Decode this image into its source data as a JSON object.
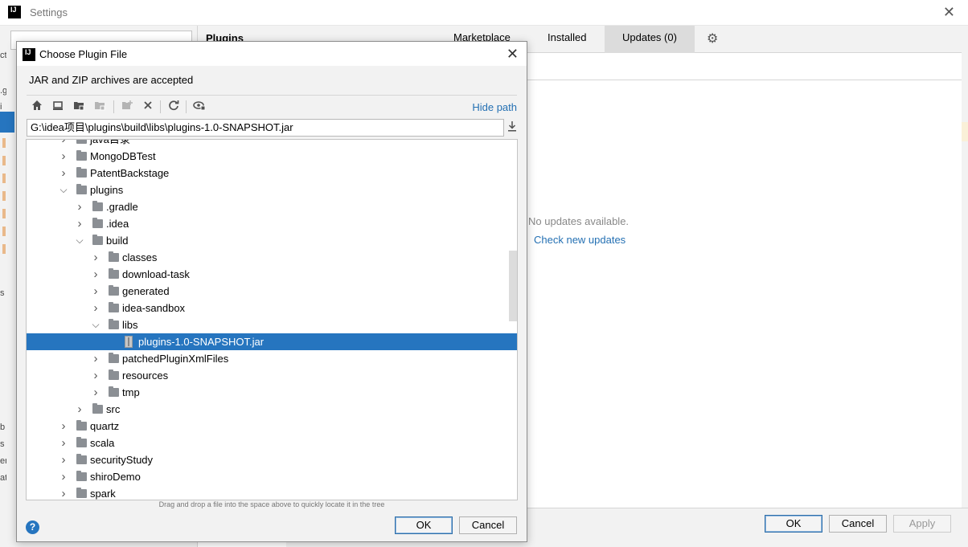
{
  "settings": {
    "logo": "IJ",
    "title": "Settings",
    "close_icon": "✕",
    "left_strip": [
      "ct",
      ".g",
      "i",
      "b",
      "s",
      "b",
      "s",
      "er",
      "at"
    ],
    "plugins": {
      "title": "Plugins",
      "tabs": [
        "Marketplace",
        "Installed",
        "Updates (0)"
      ],
      "active_tab": "Updates (0)",
      "gear_icon": "⚙"
    },
    "content": {
      "no_updates": "No updates available.",
      "check_link": "Check new updates"
    },
    "footer": {
      "ok": "OK",
      "cancel": "Cancel",
      "apply": "Apply"
    }
  },
  "dialog": {
    "logo": "IJ",
    "title": "Choose Plugin File",
    "close_icon": "✕",
    "description": "JAR and ZIP archives are accepted",
    "toolbar": {
      "icons": [
        "home-icon",
        "desktop-icon",
        "project-folder-icon",
        "module-folder-icon",
        "new-folder-icon",
        "delete-icon",
        "refresh-icon",
        "show-hidden-icon"
      ],
      "hide_path": "Hide path"
    },
    "path": "G:\\idea项目\\plugins\\build\\libs\\plugins-1.0-SNAPSHOT.jar",
    "tree": [
      {
        "label": "java目录",
        "depth": 0,
        "state": "collapsed",
        "type": "folder",
        "partial": true
      },
      {
        "label": "MongoDBTest",
        "depth": 0,
        "state": "collapsed",
        "type": "folder"
      },
      {
        "label": "PatentBackstage",
        "depth": 0,
        "state": "collapsed",
        "type": "folder"
      },
      {
        "label": "plugins",
        "depth": 0,
        "state": "expanded",
        "type": "folder"
      },
      {
        "label": ".gradle",
        "depth": 1,
        "state": "collapsed",
        "type": "folder"
      },
      {
        "label": ".idea",
        "depth": 1,
        "state": "collapsed",
        "type": "folder"
      },
      {
        "label": "build",
        "depth": 1,
        "state": "expanded",
        "type": "folder"
      },
      {
        "label": "classes",
        "depth": 2,
        "state": "collapsed",
        "type": "folder"
      },
      {
        "label": "download-task",
        "depth": 2,
        "state": "collapsed",
        "type": "folder"
      },
      {
        "label": "generated",
        "depth": 2,
        "state": "collapsed",
        "type": "folder"
      },
      {
        "label": "idea-sandbox",
        "depth": 2,
        "state": "collapsed",
        "type": "folder"
      },
      {
        "label": "libs",
        "depth": 2,
        "state": "expanded",
        "type": "folder"
      },
      {
        "label": "plugins-1.0-SNAPSHOT.jar",
        "depth": 3,
        "state": "leaf",
        "type": "jar",
        "selected": true
      },
      {
        "label": "patchedPluginXmlFiles",
        "depth": 2,
        "state": "collapsed",
        "type": "folder"
      },
      {
        "label": "resources",
        "depth": 2,
        "state": "collapsed",
        "type": "folder"
      },
      {
        "label": "tmp",
        "depth": 2,
        "state": "collapsed",
        "type": "folder"
      },
      {
        "label": "src",
        "depth": 1,
        "state": "collapsed",
        "type": "folder"
      },
      {
        "label": "quartz",
        "depth": 0,
        "state": "collapsed",
        "type": "folder"
      },
      {
        "label": "scala",
        "depth": 0,
        "state": "collapsed",
        "type": "folder"
      },
      {
        "label": "securityStudy",
        "depth": 0,
        "state": "collapsed",
        "type": "folder"
      },
      {
        "label": "shiroDemo",
        "depth": 0,
        "state": "collapsed",
        "type": "folder"
      },
      {
        "label": "spark",
        "depth": 0,
        "state": "collapsed",
        "type": "folder"
      }
    ],
    "hint": "Drag and drop a file into the space above to quickly locate it in the tree",
    "help_icon": "?",
    "ok": "OK",
    "cancel": "Cancel"
  },
  "colors": {
    "accent": "#2675bf",
    "link": "#2470b3",
    "selection": "#2675bf"
  }
}
